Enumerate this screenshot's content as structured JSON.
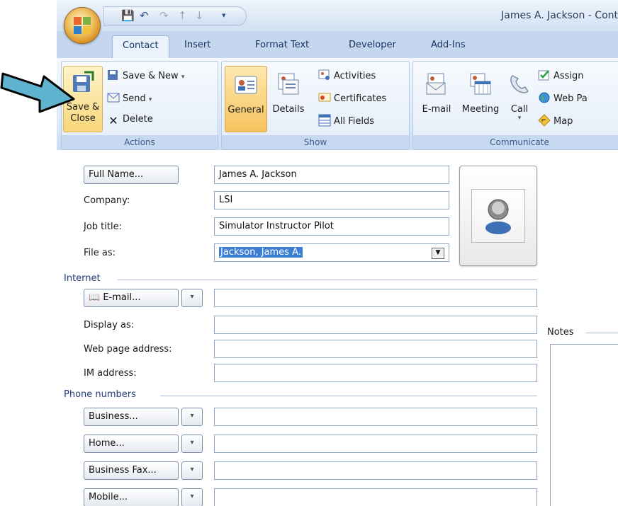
{
  "window": {
    "title": "James A. Jackson - Cont",
    "qat": {
      "save_icon": "save-icon",
      "undo_icon": "undo-icon",
      "redo_icon": "redo-icon",
      "customize_icon": "chevron-down-icon"
    }
  },
  "ribbon": {
    "tabs": [
      "Contact",
      "Insert",
      "Format Text",
      "Developer",
      "Add-Ins"
    ],
    "groups": {
      "actions": {
        "label": "Actions",
        "save_close": "Save &\nClose",
        "save_new": "Save & New",
        "send": "Send",
        "delete": "Delete"
      },
      "show": {
        "label": "Show",
        "general": "General",
        "details": "Details",
        "activities": "Activities",
        "certificates": "Certificates",
        "all_fields": "All Fields"
      },
      "communicate": {
        "label": "Communicate",
        "email": "E-mail",
        "meeting": "Meeting",
        "call": "Call",
        "assign": "Assign",
        "web_page": "Web Pa",
        "map": "Map"
      }
    }
  },
  "form": {
    "full_name_button": "Full Name...",
    "full_name_value": "James A. Jackson",
    "company_label": "Company:",
    "company_value": "LSI",
    "job_title_label": "Job title:",
    "job_title_value": "Simulator Instructor Pilot",
    "file_as_label": "File as:",
    "file_as_value": "Jackson, James A.",
    "internet_section": "Internet",
    "email_button": "E-mail...",
    "email_value": "",
    "display_as_label": "Display as:",
    "display_as_value": "",
    "web_page_label": "Web page address:",
    "web_page_value": "",
    "im_label": "IM address:",
    "im_value": "",
    "phone_section": "Phone numbers",
    "business_button": "Business...",
    "business_value": "",
    "home_button": "Home...",
    "home_value": "",
    "business_fax_button": "Business Fax...",
    "business_fax_value": "",
    "mobile_button": "Mobile...",
    "mobile_value": "",
    "notes_label": "Notes"
  },
  "colors": {
    "ribbon_bg": "#dde9f7",
    "accent": "#3b7ed3",
    "arrow": "#5fb3cf"
  }
}
